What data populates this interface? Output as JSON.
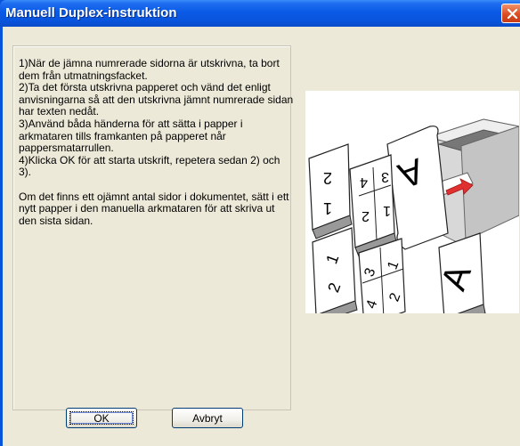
{
  "window": {
    "title": "Manuell Duplex-instruktion",
    "close_icon": "close-icon"
  },
  "instructions": {
    "text": "1)När de jämna numrerade sidorna är utskrivna, ta bort dem från utmatningsfacket.\n2)Ta det första utskrivna papperet och vänd det enligt anvisningarna så att den utskrivna jämnt numrerade sidan har texten nedåt.\n3)Använd båda händerna för att sätta i papper i arkmataren tills framkanten på papperet når pappersmatarrullen.\n4)Klicka OK för att starta utskrift, repetera sedan 2) och 3).\n\n Om det finns ett ojämnt antal sidor i dokumentet, sätt i ett nytt papper i den manuella arkmataren för att skriva ut den sista sidan."
  },
  "illustration": {
    "icon": "duplex-printer-illustration",
    "page_labels": [
      "2",
      "1",
      "4",
      "3",
      "2",
      "1",
      "1",
      "2",
      "3",
      "4",
      "1",
      "2",
      "A",
      "A"
    ],
    "colors": {
      "arrow": "#e03030",
      "tray": "#9a9a9a",
      "printer": "#d8d8d8"
    }
  },
  "buttons": {
    "ok_label": "OK",
    "cancel_label": "Avbryt"
  }
}
